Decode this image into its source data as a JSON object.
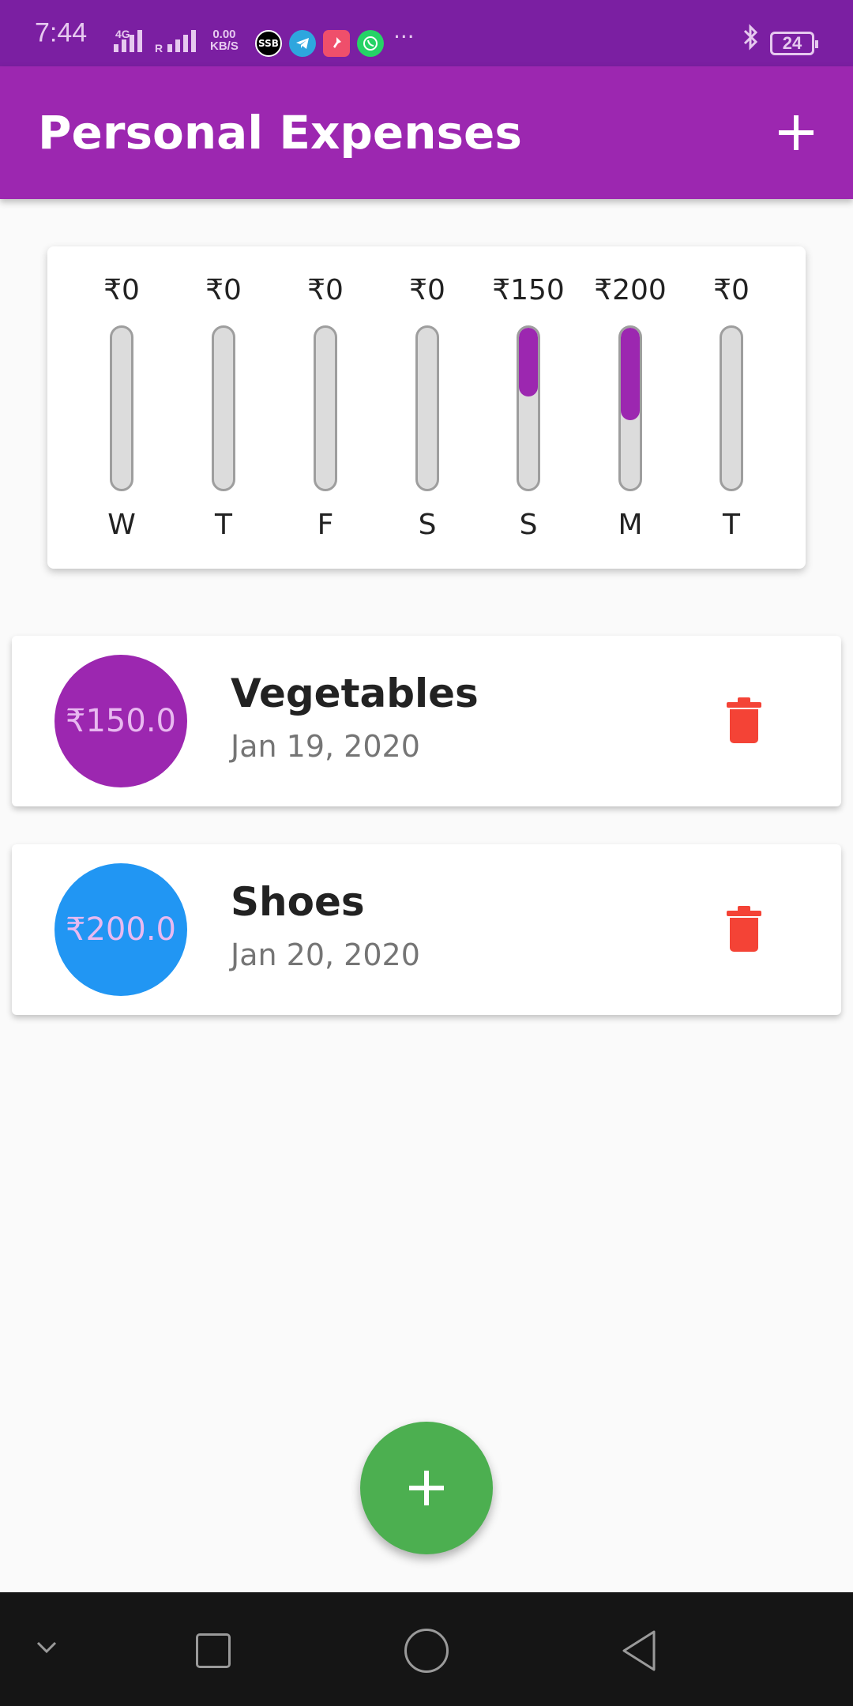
{
  "status_bar": {
    "time": "7:44",
    "network": "4G",
    "roaming": "R",
    "speed_value": "0.00",
    "speed_unit": "KB/S",
    "apps": [
      {
        "icon": "ssb-app-icon",
        "label": "SSB",
        "color": "#000000"
      },
      {
        "icon": "telegram-icon",
        "label": "",
        "color": "#2ea6de"
      },
      {
        "icon": "app-icon",
        "label": "",
        "color": "#ef4f6b"
      },
      {
        "icon": "whatsapp-icon",
        "label": "",
        "color": "#25d366"
      }
    ],
    "more": "···",
    "battery": "24"
  },
  "app_bar": {
    "title": "Personal Expenses"
  },
  "chart": {
    "bars": [
      {
        "day": "W",
        "amount": "₹0",
        "fill": 0
      },
      {
        "day": "T",
        "amount": "₹0",
        "fill": 0
      },
      {
        "day": "F",
        "amount": "₹0",
        "fill": 0
      },
      {
        "day": "S",
        "amount": "₹0",
        "fill": 0
      },
      {
        "day": "S",
        "amount": "₹150",
        "fill": 0.4286
      },
      {
        "day": "M",
        "amount": "₹200",
        "fill": 0.5714
      },
      {
        "day": "T",
        "amount": "₹0",
        "fill": 0
      }
    ],
    "fill_color": "#9c27b0"
  },
  "transactions": [
    {
      "amount": "₹150.0",
      "title": "Vegetables",
      "date": "Jan 19, 2020",
      "avatar_color": "#9c27b0"
    },
    {
      "amount": "₹200.0",
      "title": "Shoes",
      "date": "Jan 20, 2020",
      "avatar_color": "#2196f3"
    }
  ],
  "colors": {
    "primary": "#9c27b0",
    "status_bar": "#7b1fa2",
    "fab": "#4caf50",
    "delete": "#f44336"
  }
}
